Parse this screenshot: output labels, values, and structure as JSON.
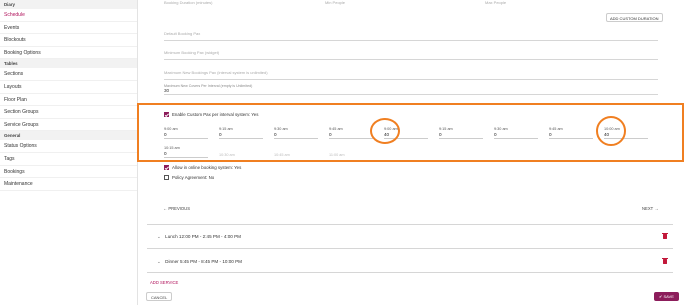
{
  "sidebar": {
    "items": [
      {
        "label": "Diary",
        "type": "head"
      },
      {
        "label": "Schedule",
        "type": "item",
        "active": true
      },
      {
        "label": "Events",
        "type": "item"
      },
      {
        "label": "Blockouts",
        "type": "item"
      },
      {
        "label": "Booking Options",
        "type": "item"
      },
      {
        "label": "Tables",
        "type": "head"
      },
      {
        "label": "Sections",
        "type": "item"
      },
      {
        "label": "Layouts",
        "type": "item"
      },
      {
        "label": "Floor Plan",
        "type": "item"
      },
      {
        "label": "Section Groups",
        "type": "item"
      },
      {
        "label": "Service Groups",
        "type": "item"
      },
      {
        "label": "General",
        "type": "head"
      },
      {
        "label": "Status Options",
        "type": "item"
      },
      {
        "label": "Tags",
        "type": "item"
      },
      {
        "label": "Bookings",
        "type": "item"
      },
      {
        "label": "Maintenance",
        "type": "item"
      }
    ]
  },
  "form": {
    "top_labels": [
      "Booking Duration (minutes)",
      "Min People",
      "Max People"
    ],
    "add_custom_duration": "ADD CUSTOM DURATION",
    "default_booking_pax": "Default Booking Pax",
    "minimum_booking_pax": "Minimum Booking Pax (widget)",
    "maximum_booking_pax": "Maximum New Bookings Pax (interval system is unlimited)",
    "max_covers_label": "Maximum New Covers Per Interval (empty is Unlimited)",
    "max_covers_value": "30",
    "enable_custom_pax": "Enable Custom Pax per interval system: Yes",
    "slots_row1": [
      {
        "time": "9:00 am",
        "value": "0"
      },
      {
        "time": "9:15 am",
        "value": "0"
      },
      {
        "time": "9:30 am",
        "value": "0"
      },
      {
        "time": "9:45 am",
        "value": "0"
      },
      {
        "time": "9:00 am",
        "value": "40"
      },
      {
        "time": "9:15 am",
        "value": "0"
      },
      {
        "time": "9:30 am",
        "value": "0"
      },
      {
        "time": "9:45 am",
        "value": "0"
      },
      {
        "time": "10:00 am",
        "value": "40"
      }
    ],
    "slots_row2": [
      {
        "time": "10:15 am",
        "value": "0"
      }
    ],
    "ghost_times": [
      "10:30 am",
      "10:45 am",
      "11:00 am"
    ],
    "allow_online": "Allow in online booking system: Yes",
    "policy_agreement": "Policy Agreement: No",
    "previous": "PREVIOUS",
    "next": "NEXT"
  },
  "services": [
    {
      "label": "Lunch 12:00 PM - 2:45 PM - 4:00 PM"
    },
    {
      "label": "Dinner 5:45 PM - 8:45 PM - 10:00 PM"
    }
  ],
  "footer": {
    "add_service": "ADD SERVICE",
    "cancel": "CANCEL",
    "save": "SAVE"
  },
  "colors": {
    "accent": "#8c1d5b",
    "highlight": "#f07f21",
    "delete": "#c2183a"
  }
}
